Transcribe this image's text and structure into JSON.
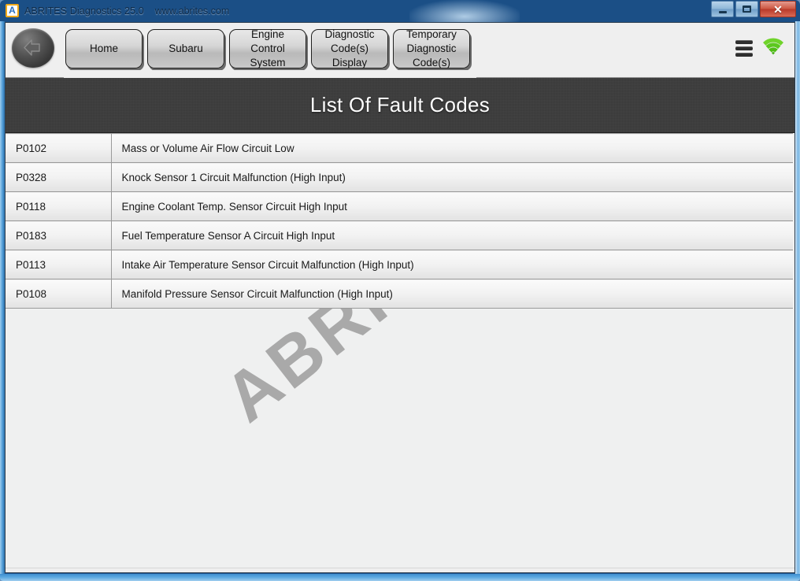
{
  "window": {
    "app_icon_letter": "A",
    "title": "ABRITES Diagnostics 25.0",
    "url": "www.abrites.com",
    "minimize_label": "Minimize",
    "maximize_label": "Maximize",
    "close_label": "✕"
  },
  "toolbar": {
    "back_label": "Back",
    "breadcrumbs": [
      {
        "label": "Home"
      },
      {
        "label": "Subaru"
      },
      {
        "label": "Engine\nControl\nSystem"
      },
      {
        "label": "Diagnostic\nCode(s)\nDisplay"
      },
      {
        "label": "Temporary\nDiagnostic\nCode(s)"
      }
    ],
    "menu_label": "Menu",
    "connection_label": "Connected"
  },
  "page": {
    "title": "List Of Fault Codes",
    "watermark": "ABRITES"
  },
  "fault_codes": [
    {
      "code": "P0102",
      "description": "Mass or Volume Air Flow Circuit Low"
    },
    {
      "code": "P0328",
      "description": "Knock Sensor 1 Circuit Malfunction (High Input)"
    },
    {
      "code": "P0118",
      "description": "Engine Coolant Temp. Sensor Circuit High Input"
    },
    {
      "code": "P0183",
      "description": "Fuel Temperature Sensor A Circuit High Input"
    },
    {
      "code": "P0113",
      "description": "Intake Air Temperature Sensor Circuit Malfunction (High Input)"
    },
    {
      "code": "P0108",
      "description": "Manifold Pressure Sensor Circuit Malfunction (High Input)"
    }
  ],
  "colors": {
    "titlebar": "#1d528c",
    "header_bg": "#3b3b3b",
    "toolbar_bg": "#efefef",
    "signal_green": "#54c21a",
    "close_red": "#bd3e2c",
    "watermark": "#a9a9a9"
  }
}
